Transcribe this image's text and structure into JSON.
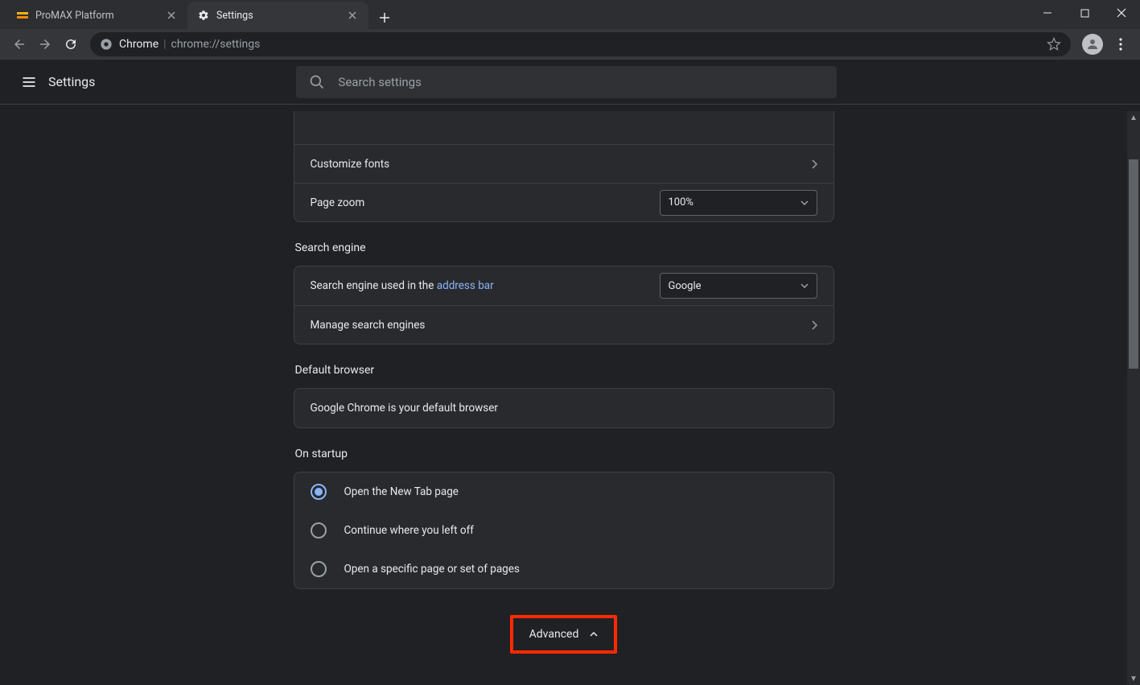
{
  "browser": {
    "tabs": [
      {
        "title": "ProMAX Platform",
        "active": false
      },
      {
        "title": "Settings",
        "active": true
      }
    ],
    "omnibox": {
      "origin": "Chrome",
      "path": "chrome://settings"
    }
  },
  "header": {
    "title": "Settings",
    "search_placeholder": "Search settings"
  },
  "appearance": {
    "customize_fonts": "Customize fonts",
    "page_zoom_label": "Page zoom",
    "page_zoom_value": "100%"
  },
  "search_engine": {
    "section_title": "Search engine",
    "used_in_label_prefix": "Search engine used in the ",
    "address_bar_link": "address bar",
    "value": "Google",
    "manage_label": "Manage search engines"
  },
  "default_browser": {
    "section_title": "Default browser",
    "status": "Google Chrome is your default browser"
  },
  "on_startup": {
    "section_title": "On startup",
    "options": [
      "Open the New Tab page",
      "Continue where you left off",
      "Open a specific page or set of pages"
    ],
    "selected_index": 0
  },
  "advanced": {
    "label": "Advanced"
  }
}
